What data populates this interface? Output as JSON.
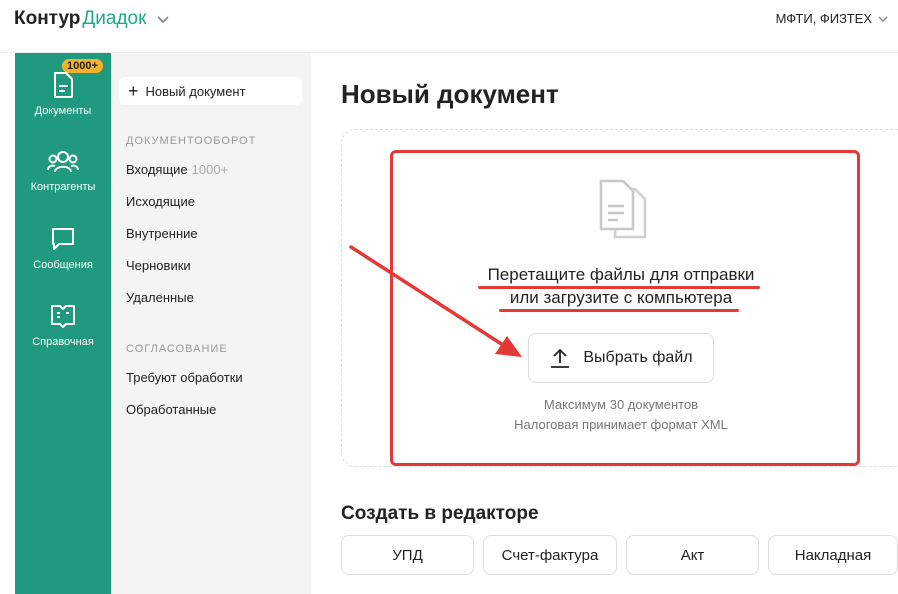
{
  "brand": {
    "part1": "Контур",
    "part2": "Диадок",
    "accent": "#1aab8a"
  },
  "org": {
    "name": "МФТИ, ФИЗТЕХ"
  },
  "leftnav": {
    "badge": "1000+",
    "items": [
      {
        "label": "Документы",
        "icon": "document-icon"
      },
      {
        "label": "Контрагенты",
        "icon": "people-icon"
      },
      {
        "label": "Сообщения",
        "icon": "chat-icon"
      },
      {
        "label": "Справочная",
        "icon": "book-icon"
      }
    ]
  },
  "sidebar": {
    "new_doc": "Новый документ",
    "section_docflow": "ДОКУМЕНТООБОРОТ",
    "docflow": [
      {
        "label": "Входящие",
        "count": "1000+"
      },
      {
        "label": "Исходящие"
      },
      {
        "label": "Внутренние"
      },
      {
        "label": "Черновики"
      },
      {
        "label": "Удаленные"
      }
    ],
    "section_approval": "СОГЛАСОВАНИЕ",
    "approval": [
      {
        "label": "Требуют обработки"
      },
      {
        "label": "Обработанные"
      }
    ]
  },
  "main": {
    "title": "Новый документ",
    "drop_line1": "Перетащите файлы для отправки",
    "drop_line2": "или загрузите с компьютера",
    "upload_button": "Выбрать файл",
    "note1": "Максимум 30 документов",
    "note2": "Налоговая принимает формат XML",
    "editor_title": "Создать в редакторе",
    "templates": [
      "УПД",
      "Счет-фактура",
      "Акт",
      "Накладная"
    ]
  },
  "colors": {
    "sidebar_green": "#1f9a7e",
    "annotation_red": "#e53935"
  }
}
